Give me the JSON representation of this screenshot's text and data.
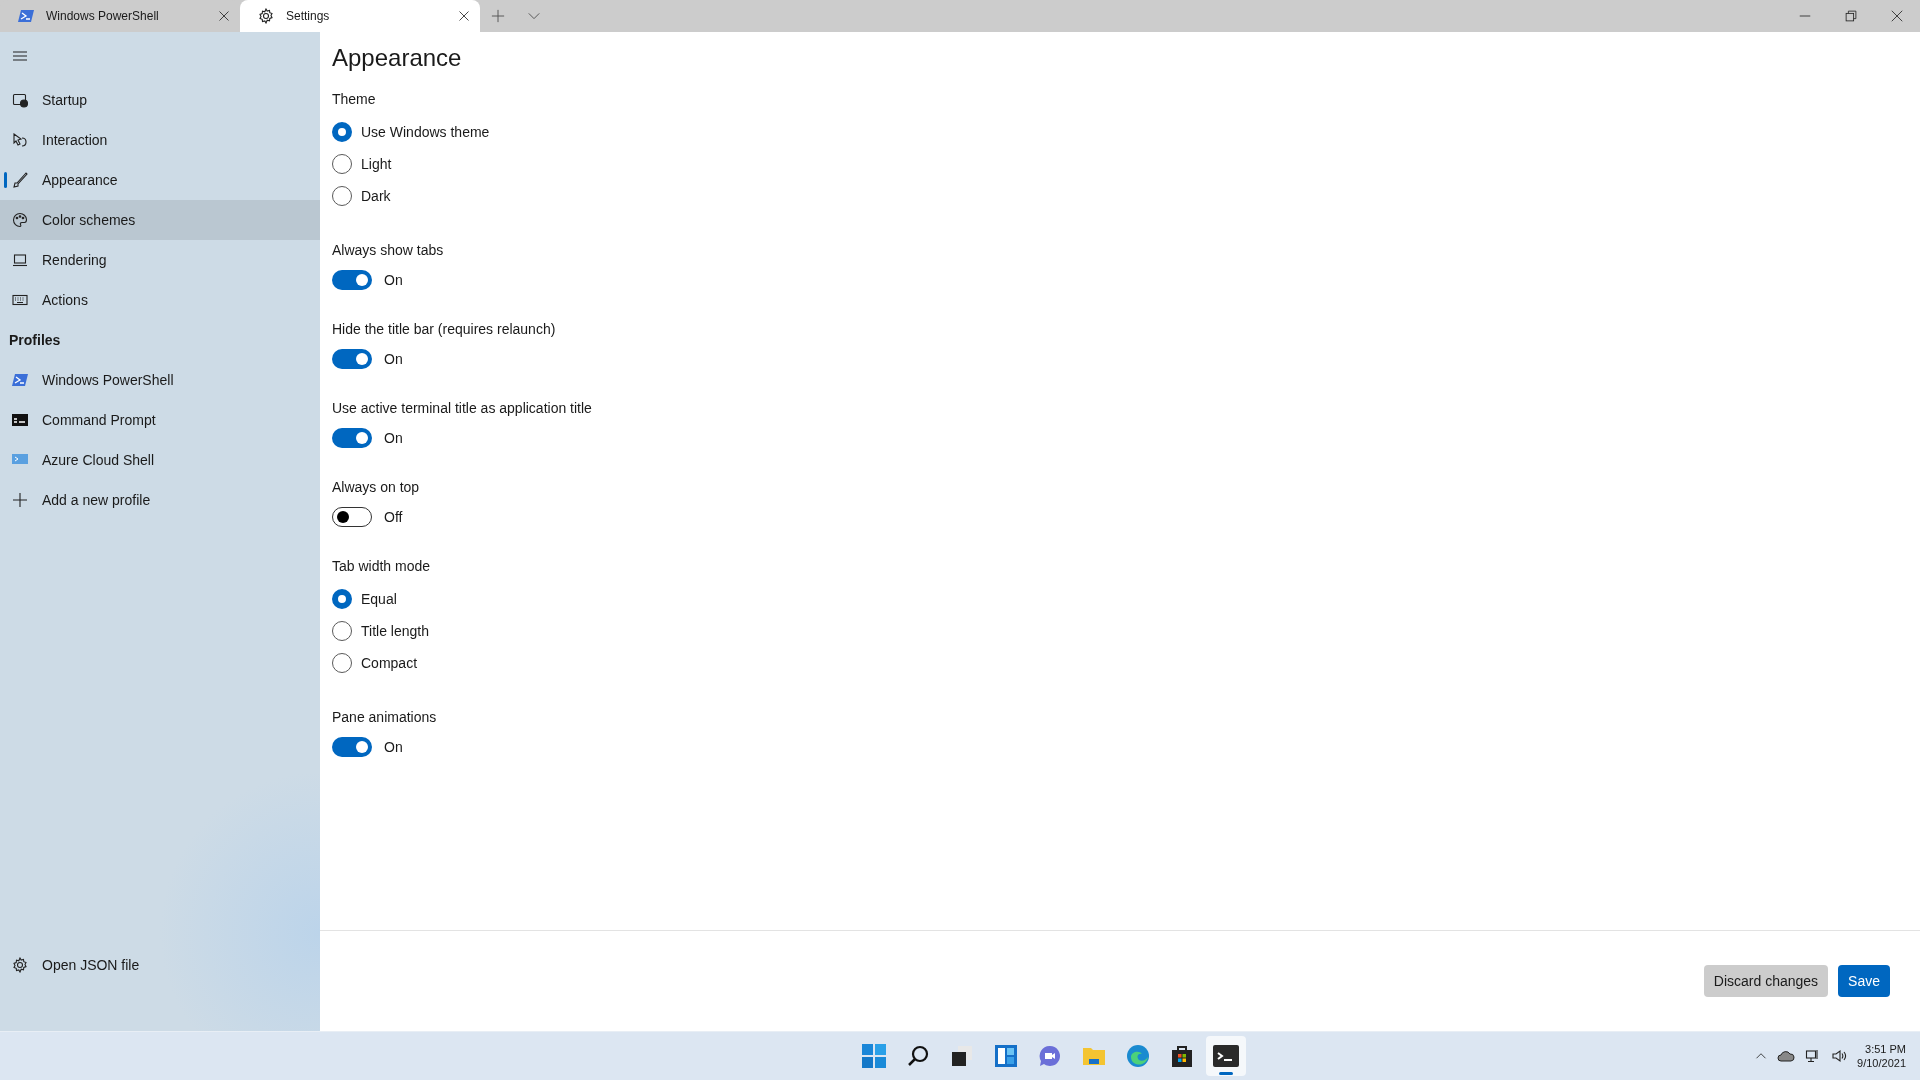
{
  "window": {
    "tabs": [
      {
        "title": "Windows PowerShell",
        "selected": false
      },
      {
        "title": "Settings",
        "selected": true
      }
    ]
  },
  "sidebar": {
    "items": [
      {
        "label": "Startup",
        "selected": false,
        "hovered": false
      },
      {
        "label": "Interaction",
        "selected": false,
        "hovered": false
      },
      {
        "label": "Appearance",
        "selected": true,
        "hovered": false
      },
      {
        "label": "Color schemes",
        "selected": false,
        "hovered": true
      },
      {
        "label": "Rendering",
        "selected": false,
        "hovered": false
      },
      {
        "label": "Actions",
        "selected": false,
        "hovered": false
      }
    ],
    "profiles_heading": "Profiles",
    "profiles": [
      {
        "label": "Windows PowerShell"
      },
      {
        "label": "Command Prompt"
      },
      {
        "label": "Azure Cloud Shell"
      },
      {
        "label": "Add a new profile"
      }
    ],
    "footer_item": {
      "label": "Open JSON file"
    }
  },
  "page": {
    "title": "Appearance",
    "settings": [
      {
        "kind": "radio",
        "label": "Theme",
        "options": [
          {
            "label": "Use Windows theme",
            "selected": true
          },
          {
            "label": "Light",
            "selected": false
          },
          {
            "label": "Dark",
            "selected": false
          }
        ]
      },
      {
        "kind": "toggle",
        "label": "Always show tabs",
        "on": true,
        "state_text": "On"
      },
      {
        "kind": "toggle",
        "label": "Hide the title bar (requires relaunch)",
        "on": true,
        "state_text": "On"
      },
      {
        "kind": "toggle",
        "label": "Use active terminal title as application title",
        "on": true,
        "state_text": "On"
      },
      {
        "kind": "toggle",
        "label": "Always on top",
        "on": false,
        "state_text": "Off"
      },
      {
        "kind": "radio",
        "label": "Tab width mode",
        "options": [
          {
            "label": "Equal",
            "selected": true
          },
          {
            "label": "Title length",
            "selected": false
          },
          {
            "label": "Compact",
            "selected": false
          }
        ]
      },
      {
        "kind": "toggle",
        "label": "Pane animations",
        "on": true,
        "state_text": "On"
      }
    ]
  },
  "footer": {
    "buttons": [
      {
        "label": "Discard changes",
        "kind": "secondary"
      },
      {
        "label": "Save",
        "kind": "primary"
      }
    ]
  },
  "taskbar": {
    "apps": [
      {
        "active": false
      },
      {
        "active": false
      },
      {
        "active": false
      },
      {
        "active": false
      },
      {
        "active": false
      },
      {
        "active": false
      },
      {
        "active": false
      },
      {
        "active": false
      },
      {
        "active": true
      }
    ],
    "clock": {
      "time": "3:51 PM",
      "date": "9/10/2021"
    }
  }
}
